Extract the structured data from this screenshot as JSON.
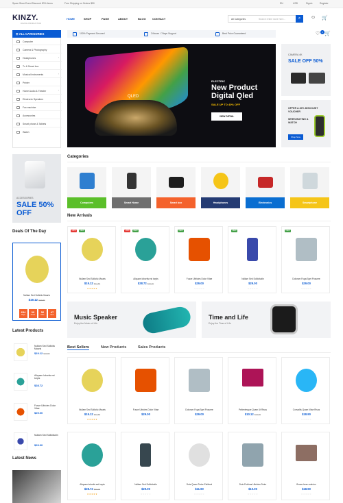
{
  "topbar": {
    "promo1": "Spare Store Event Discount 50% Items",
    "promo2": "Free Shipping on Orders $50",
    "lang": "EN",
    "currency": "USD",
    "signin": "Signin",
    "register": "Register"
  },
  "header": {
    "logo": "KINZY.",
    "logo_sub": "DIGITAL PRODUCTION",
    "nav": [
      "HOME",
      "SHOP",
      "PAGE",
      "ABOUT",
      "BLOG",
      "CONTACT"
    ],
    "search_category": "All Categories",
    "search_placeholder": "Search entire store here..."
  },
  "categories_menu": {
    "title": "ALL CATEGORIES",
    "items": [
      "Computer",
      "Camera & Photography",
      "Headphones",
      "Tv & Smart box",
      "Musical Instruments",
      "Printer",
      "Home Audio & Theater",
      "Electronic Speakers",
      "Fax machine",
      "Accessories",
      "Smart phone & Tablets",
      "Watch"
    ]
  },
  "infobar": [
    "100% Payment Secured",
    "24hours / 7days Support",
    "Best Price Guaranteed"
  ],
  "counts": {
    "wishlist": "0",
    "cart": "0"
  },
  "hero": {
    "kicker": "ELECTRIC",
    "title": "New Product Digital Qled",
    "sale": "SALE UP TO 40% OFF",
    "button": "VIEW DETAIL",
    "qled": "QLED"
  },
  "side_ads": {
    "ad1_label": "CAMERA 4K",
    "ad1_sale": "SALE OFF 50%",
    "ad2_line1": "OFFER A 40% DISCOUNT VOUCHER",
    "ad2_line2": "WHEN BUYING A WATCH",
    "ad2_button": "Shop Now"
  },
  "left_ad": {
    "label": "ACCESSORIES",
    "sale": "SALE 50% OFF"
  },
  "sections": {
    "categories": "Categories",
    "new_arrivals": "New Arrivals",
    "deal": "Deals Of The Day",
    "latest": "Latest Products",
    "news": "Latest News"
  },
  "category_cards": [
    {
      "label": "Computers",
      "color": "#5bbf2a"
    },
    {
      "label": "Smart Home",
      "color": "#6f6f6f"
    },
    {
      "label": "Smart box",
      "color": "#f4622c"
    },
    {
      "label": "Headphones",
      "color": "#243b73"
    },
    {
      "label": "Electronics",
      "color": "#0a6ed1"
    },
    {
      "label": "Smartphone",
      "color": "#f5c518"
    }
  ],
  "new_arrivals": [
    {
      "name": "Nullam Sed Sollicitu Mauris",
      "price": "$19.12",
      "old": "$22.80",
      "stars": "★★★★★",
      "badges": [
        "-20%",
        "NEW"
      ]
    },
    {
      "name": "Aliquam lobortis est turpis",
      "price": "$28.72",
      "old": "$30.00",
      "stars": "☆☆☆☆☆",
      "badges": [
        "-20%",
        "NEW"
      ]
    },
    {
      "name": "Fusce Ultricies Dolor Vitae",
      "price": "$29.00",
      "old": "",
      "stars": "☆☆☆☆☆",
      "badges": [
        "NEW"
      ]
    },
    {
      "name": "Nullam Sed Sollicitudin",
      "price": "$29.00",
      "old": "",
      "stars": "☆☆☆☆☆",
      "badges": [
        "NEW"
      ]
    },
    {
      "name": "Dolorum Fuga Eget Posuere",
      "price": "$29.00",
      "old": "",
      "stars": "☆☆☆☆☆",
      "badges": [
        "NEW"
      ]
    }
  ],
  "deal": {
    "name": "Nullam Sed Sollicitu Mauris",
    "price": "$19.12",
    "old": "$22.80",
    "timer": [
      {
        "v": "634",
        "l": "Days"
      },
      {
        "v": "09",
        "l": "Hours"
      },
      {
        "v": "56",
        "l": "Mins"
      },
      {
        "v": "47",
        "l": "Secs"
      }
    ]
  },
  "banners": [
    {
      "title": "Music Speaker",
      "sub": "Enjoy the Music of Life"
    },
    {
      "title": "Time and Life",
      "sub": "Enjoy the Time of Life"
    }
  ],
  "latest_products": [
    {
      "name": "Nullam Sed Sollicitu Mauris",
      "price": "$19.12",
      "old": "$22.80"
    },
    {
      "name": "Aliquam lobortis est turpis",
      "price": "$28.72",
      "old": ""
    },
    {
      "name": "Fusce Ultricies Dolor Vitae",
      "price": "$29.00",
      "old": ""
    },
    {
      "name": "Nullam Sed Sollicitudin",
      "price": "$29.00",
      "old": ""
    }
  ],
  "tabs": [
    "Best Sellers",
    "New Products",
    "Sales Products"
  ],
  "best_row1": [
    {
      "name": "Nullam Sed Sollicitu Mauris",
      "price": "$19.12",
      "old": "$22.80",
      "stars": "★★★★★"
    },
    {
      "name": "Fusce Ultricies Dolor Vitae",
      "price": "$29.00",
      "old": "",
      "stars": "☆☆☆☆☆"
    },
    {
      "name": "Dolorum Fuga Eget Posuere",
      "price": "$29.00",
      "old": "",
      "stars": "☆☆☆☆☆"
    },
    {
      "name": "Pellentesque Quam Ut Risus",
      "price": "$10.12",
      "old": "$12.00",
      "stars": "☆☆☆☆☆"
    },
    {
      "name": "Convallis Quam Vitae Risus",
      "price": "$18.90",
      "old": "",
      "stars": "☆☆☆☆☆"
    }
  ],
  "best_row2": [
    {
      "name": "Aliquam lobortis est turpis",
      "price": "$28.72",
      "old": "$30.00",
      "stars": "★★★★★"
    },
    {
      "name": "Nullam Sed Sollicitudin",
      "price": "$29.00",
      "old": "",
      "stars": "☆☆☆☆☆"
    },
    {
      "name": "Duis Quam Tortor Eleifend",
      "price": "$11.90",
      "old": "",
      "stars": "☆☆☆☆☆"
    },
    {
      "name": "Duis Pulvinar Ultricies Dolor",
      "price": "$10.00",
      "old": "",
      "stars": "☆☆☆☆☆"
    },
    {
      "name": "Brown bear cushion",
      "price": "$18.90",
      "old": "",
      "stars": "☆☆☆☆☆"
    }
  ]
}
